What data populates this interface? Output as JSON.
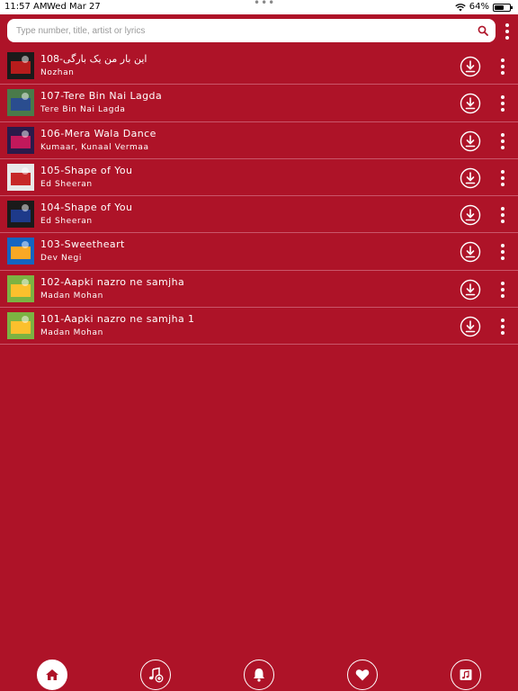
{
  "status_bar": {
    "time": "11:57 AM",
    "date": "Wed Mar 27",
    "battery_percent": "64%",
    "battery_level": 0.64
  },
  "search": {
    "placeholder": "Type number, title, artist or lyrics",
    "value": ""
  },
  "songs": [
    {
      "title": "108-این بار من یک بارگی",
      "artist": "Nozhan",
      "thumb_colors": [
        "#1a1a1a",
        "#b71c1c"
      ]
    },
    {
      "title": "107-Tere Bin Nai Lagda",
      "artist": "Tere Bin Nai Lagda",
      "thumb_colors": [
        "#4a7a4a",
        "#2a4d8f"
      ]
    },
    {
      "title": "106-Mera Wala Dance",
      "artist": "Kumaar, Kunaal Vermaa",
      "thumb_colors": [
        "#2b1a4a",
        "#c2185b"
      ]
    },
    {
      "title": "105-Shape of You",
      "artist": "Ed Sheeran",
      "thumb_colors": [
        "#e8e8e8",
        "#c62828"
      ]
    },
    {
      "title": "104-Shape of You",
      "artist": "Ed Sheeran",
      "thumb_colors": [
        "#1a1a1a",
        "#1e3a8a"
      ]
    },
    {
      "title": "103-Sweetheart",
      "artist": "Dev Negi",
      "thumb_colors": [
        "#1565c0",
        "#f9a825"
      ]
    },
    {
      "title": "102-Aapki nazro ne samjha",
      "artist": "Madan Mohan",
      "thumb_colors": [
        "#7cb342",
        "#fbc02d"
      ]
    },
    {
      "title": "101-Aapki nazro ne samjha 1",
      "artist": "Madan Mohan",
      "thumb_colors": [
        "#7cb342",
        "#fbc02d"
      ]
    }
  ],
  "bottom_nav": [
    {
      "name": "home",
      "icon": "home-icon",
      "active": true
    },
    {
      "name": "add-song",
      "icon": "music-plus-icon",
      "active": false
    },
    {
      "name": "notifications",
      "icon": "bell-icon",
      "active": false
    },
    {
      "name": "favorites",
      "icon": "heart-icon",
      "active": false
    },
    {
      "name": "playlist",
      "icon": "music-folder-icon",
      "active": false
    }
  ],
  "colors": {
    "background": "#ae1328",
    "divider": "#c9566a",
    "active_icon": "#ae1328"
  }
}
